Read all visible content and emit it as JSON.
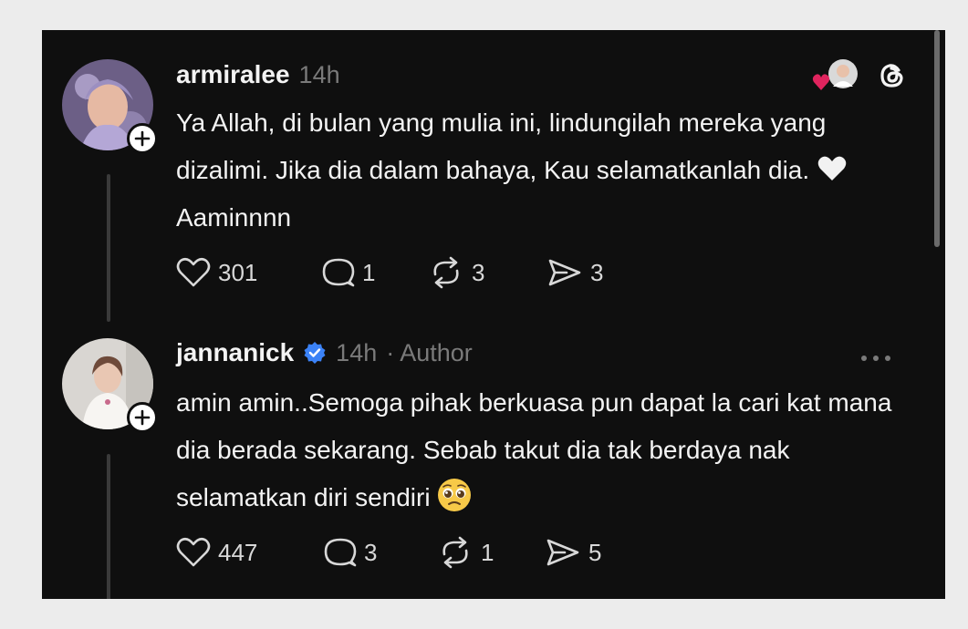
{
  "posts": [
    {
      "username": "armiralee",
      "time": "14h",
      "author_tag": "",
      "text_before_emoji": "Ya Allah, di bulan yang mulia ini, lindungilah mereka yang dizalimi. Jika dia dalam bahaya, Kau selamatkanlah dia.",
      "text_after_emoji": "Aaminnnn",
      "emoji": "white-heart",
      "likes": "301",
      "replies": "1",
      "reposts": "3",
      "shares": "3"
    },
    {
      "username": "jannanick",
      "time": "14h",
      "author_tag": "· Author",
      "verified": true,
      "text_before_emoji": "amin amin..Semoga pihak berkuasa pun dapat la cari kat mana dia berada sekarang. Sebab takut dia tak berdaya nak selamatkan diri sendiri",
      "text_after_emoji": "",
      "emoji": "pleading-face",
      "likes": "447",
      "replies": "3",
      "reposts": "1",
      "shares": "5"
    }
  ],
  "colors": {
    "background": "#0f0f0f",
    "text": "#f3f3f3",
    "muted": "#7a7a7a",
    "verified": "#3b82f6",
    "like_heart": "#e0245e"
  },
  "icons": [
    "add-follow-icon",
    "liked-by-author-icon",
    "threads-logo-icon",
    "heart-icon",
    "reply-icon",
    "repost-icon",
    "share-icon",
    "more-options-icon",
    "verified-badge-icon"
  ]
}
